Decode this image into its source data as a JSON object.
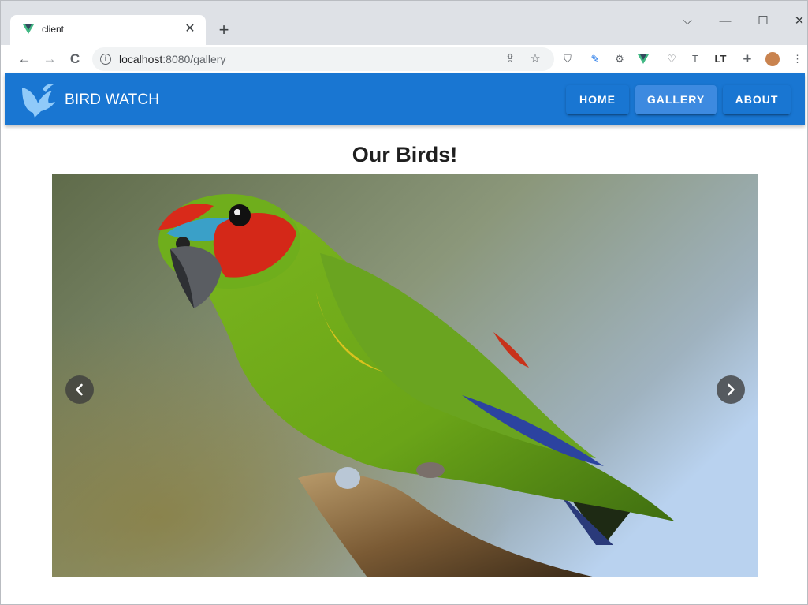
{
  "browser": {
    "tab_title": "client",
    "tab_close": "✕",
    "new_tab": "+",
    "url_host": "localhost",
    "url_rest": ":8080/gallery",
    "window_controls": {
      "chevron": "⌵",
      "minimize": "—",
      "maximize": "☐",
      "close": "✕"
    },
    "nav": {
      "back": "←",
      "forward": "→",
      "reload": "C"
    },
    "icons": [
      "share-icon",
      "bookmark-star-icon",
      "ublock-icon",
      "eyedropper-icon",
      "settings-cog-icon",
      "vue-devtools-icon",
      "pocket-icon",
      "text-icon",
      "languagetool-icon",
      "extensions-puzzle-icon",
      "profile-avatar-icon",
      "menu-kebab-icon"
    ]
  },
  "appbar": {
    "brand": "BIRD WATCH",
    "nav": [
      {
        "label": "HOME",
        "active": false
      },
      {
        "label": "GALLERY",
        "active": true
      },
      {
        "label": "ABOUT",
        "active": false
      }
    ],
    "color": "#1976d2"
  },
  "main": {
    "title": "Our Birds!",
    "carousel": {
      "prev_icon": "chevron-left-icon",
      "next_icon": "chevron-right-icon",
      "slide_subject": "green parrot on branch"
    }
  }
}
